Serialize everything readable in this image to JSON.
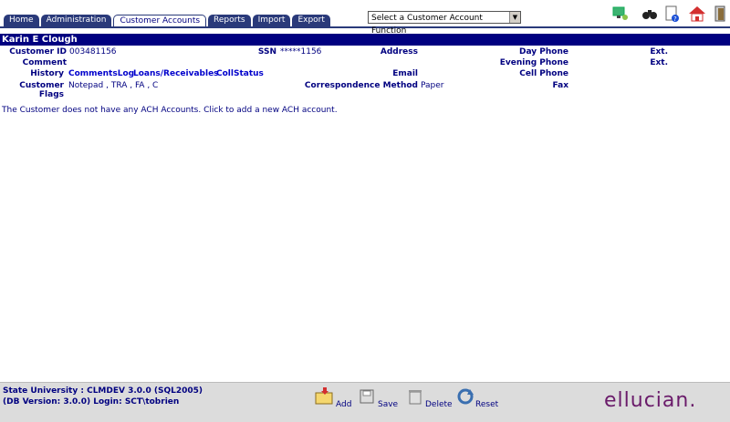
{
  "tabs": [
    {
      "label": "Home"
    },
    {
      "label": "Administration"
    },
    {
      "label": "Customer Accounts",
      "active": true
    },
    {
      "label": "Reports"
    },
    {
      "label": "Import"
    },
    {
      "label": "Export"
    }
  ],
  "function_select": {
    "value": "Select a Customer Account Function"
  },
  "toolbar_icons": [
    "network-icon",
    "binoculars-icon",
    "help-document-icon",
    "home-icon",
    "logout-icon"
  ],
  "customer": {
    "name": "Karin E Clough",
    "customer_id_label": "Customer ID",
    "customer_id": "003481156",
    "ssn_label": "SSN",
    "ssn": "*****1156",
    "comment_label": "Comment",
    "history_label": "History",
    "links": [
      "CommentsLog",
      "Loans/Receivables",
      "CollStatus"
    ],
    "flags_label": "Customer Flags",
    "flags": "Notepad , TRA , FA , C",
    "address_label": "Address",
    "email_label": "Email",
    "corr_label": "Correspondence Method",
    "corr_value": "Paper",
    "day_phone_label": "Day Phone",
    "evening_phone_label": "Evening Phone",
    "cell_phone_label": "Cell Phone",
    "fax_label": "Fax",
    "ext_label": "Ext."
  },
  "message": "The Customer does not have any ACH Accounts. Click to add a new ACH account.",
  "footer": {
    "line1": "State University : CLMDEV 3.0.0 (SQL2005)",
    "line2": "(DB Version: 3.0.0) Login: SCT\\tobrien",
    "buttons": [
      {
        "label": "Add"
      },
      {
        "label": "Save"
      },
      {
        "label": "Delete"
      },
      {
        "label": "Reset"
      }
    ],
    "logo": "ellucian."
  }
}
